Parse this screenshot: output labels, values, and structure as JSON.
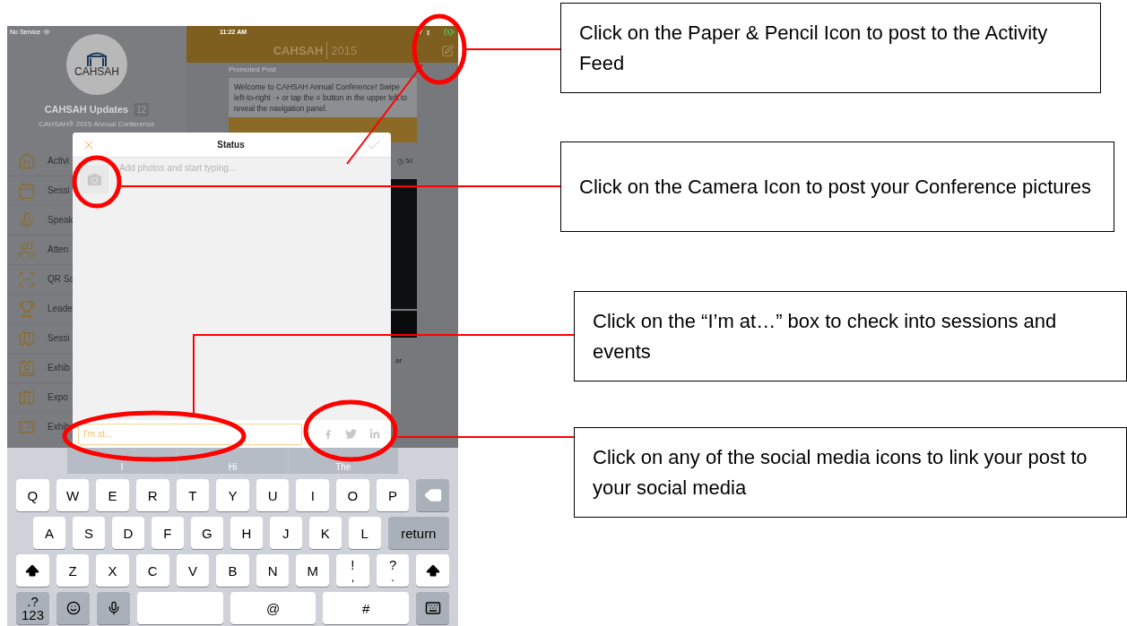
{
  "status_bar": {
    "carrier": "No Service",
    "time": "11:22 AM"
  },
  "sidebar": {
    "logo_text": "CAHSAH",
    "title": "CAHSAH Updates",
    "badge": "12",
    "subtitle": "CAHSAH® 2015 Annual Conference",
    "items": [
      {
        "kind": "home",
        "label": "Activi"
      },
      {
        "kind": "calendar",
        "label": "Sessi"
      },
      {
        "kind": "mic",
        "label": "Speak"
      },
      {
        "kind": "people",
        "label": "Atten"
      },
      {
        "kind": "scan",
        "label": "QR Sc"
      },
      {
        "kind": "trophy",
        "label": "Leade"
      },
      {
        "kind": "map",
        "label": "Sessi"
      },
      {
        "kind": "badge",
        "label": "Exhib"
      },
      {
        "kind": "map",
        "label": "Expo"
      },
      {
        "kind": "ticket",
        "label": "Exhib"
      }
    ]
  },
  "header": {
    "title": "CAHSAH",
    "year": "2015"
  },
  "feed": {
    "promoted_label": "Promoted Post",
    "promoted_text": "Welcome to CAHSAH Annual Conference! Swipe left-to-right ➝ or tap the ≡ button in the upper left to reveal the navigation panel.",
    "post_age": "5d",
    "post_snippet": "ar"
  },
  "status_dialog": {
    "title": "Status",
    "placeholder": "Add photos and start typing...",
    "location_placeholder": "I'm at..."
  },
  "keyboard": {
    "suggestions": [
      "I",
      "Hi",
      "The"
    ],
    "key_rows": [
      {
        "keys": [
          {
            "kind": "char",
            "label": "Q"
          },
          {
            "kind": "char",
            "label": "W"
          },
          {
            "kind": "char",
            "label": "E"
          },
          {
            "kind": "char",
            "label": "R"
          },
          {
            "kind": "char",
            "label": "T"
          },
          {
            "kind": "char",
            "label": "Y"
          },
          {
            "kind": "char",
            "label": "U"
          },
          {
            "kind": "char",
            "label": "I"
          },
          {
            "kind": "char",
            "label": "O"
          },
          {
            "kind": "char",
            "label": "P"
          },
          {
            "kind": "delete"
          }
        ]
      },
      {
        "keys": [
          {
            "kind": "char",
            "label": "A"
          },
          {
            "kind": "char",
            "label": "S"
          },
          {
            "kind": "char",
            "label": "D"
          },
          {
            "kind": "char",
            "label": "F"
          },
          {
            "kind": "char",
            "label": "G"
          },
          {
            "kind": "char",
            "label": "H"
          },
          {
            "kind": "char",
            "label": "J"
          },
          {
            "kind": "char",
            "label": "K"
          },
          {
            "kind": "char",
            "label": "L"
          },
          {
            "kind": "return",
            "label": "return"
          }
        ]
      },
      {
        "keys": [
          {
            "kind": "shift"
          },
          {
            "kind": "char",
            "label": "Z"
          },
          {
            "kind": "char",
            "label": "X"
          },
          {
            "kind": "char",
            "label": "C"
          },
          {
            "kind": "char",
            "label": "V"
          },
          {
            "kind": "char",
            "label": "B"
          },
          {
            "kind": "char",
            "label": "N"
          },
          {
            "kind": "char",
            "label": "M"
          },
          {
            "kind": "char",
            "label": "!",
            "sub": ","
          },
          {
            "kind": "char",
            "label": "?",
            "sub": "."
          },
          {
            "kind": "shift"
          }
        ]
      },
      {
        "keys": [
          {
            "kind": "numbers",
            "label": ".?123"
          },
          {
            "kind": "emoji"
          },
          {
            "kind": "dictation"
          },
          {
            "kind": "space"
          },
          {
            "kind": "char",
            "label": "@"
          },
          {
            "kind": "char",
            "label": "#"
          },
          {
            "kind": "hide"
          }
        ]
      }
    ]
  },
  "callouts": [
    {
      "text": "Click on the Paper & Pencil Icon to post to the Activity Feed"
    },
    {
      "text": "Click on the Camera Icon to post your Conference pictures"
    },
    {
      "text": "Click on the “I’m at…” box to check into sessions and events"
    },
    {
      "text": "Click on any of the social media icons to link your post to your social media"
    }
  ]
}
